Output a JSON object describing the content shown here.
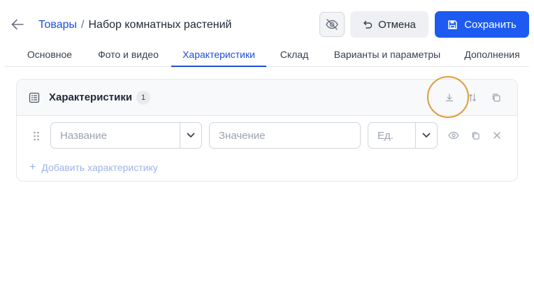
{
  "header": {
    "breadcrumb_parent": "Товары",
    "breadcrumb_separator": "/",
    "breadcrumb_current": "Набор комнатных растений",
    "cancel_label": "Отмена",
    "save_label": "Сохранить"
  },
  "tabs": [
    {
      "label": "Основное",
      "active": false
    },
    {
      "label": "Фото и видео",
      "active": false
    },
    {
      "label": "Характеристики",
      "active": true
    },
    {
      "label": "Склад",
      "active": false
    },
    {
      "label": "Варианты и параметры",
      "active": false
    },
    {
      "label": "Дополнения",
      "active": false
    }
  ],
  "card": {
    "title": "Характеристики",
    "count": "1",
    "row": {
      "name_placeholder": "Название",
      "value_placeholder": "Значение",
      "unit_placeholder": "Ед."
    },
    "add_label": "Добавить характеристику"
  },
  "icons": {
    "back": "arrow-left-icon",
    "hide": "eye-off-icon",
    "cancel": "undo-icon",
    "save": "floppy-disk-icon",
    "card": "list-icon",
    "download": "download-icon",
    "sort": "sort-arrows-icon",
    "copy": "copy-icon",
    "drag": "drag-handle-icon",
    "chevron": "chevron-down-icon",
    "eye": "eye-icon",
    "close": "close-icon",
    "plus": "plus-icon"
  },
  "colors": {
    "primary": "#1d5bf0",
    "link": "#1d4ed8",
    "highlight": "#e09a3b",
    "add_link": "#9db4e8"
  }
}
